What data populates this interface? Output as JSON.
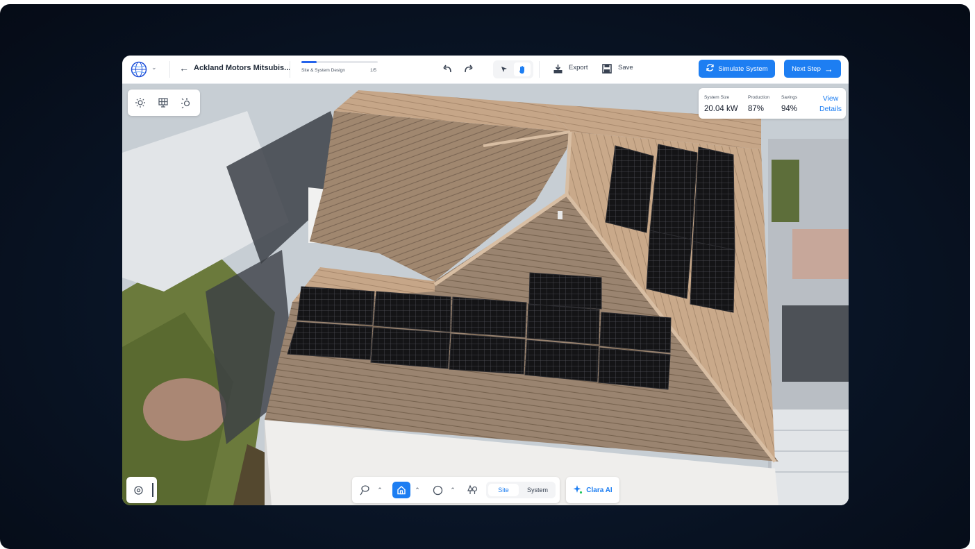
{
  "project": {
    "title": "Ackland Motors Mitsubis...",
    "step_label": "Site & System Design",
    "step_count": "1/5",
    "progress": 0.2
  },
  "toolbar": {
    "export_label": "Export",
    "save_label": "Save",
    "simulate_label": "Simulate System",
    "next_label": "Next Step"
  },
  "stats": {
    "system_size_label": "System Size",
    "system_size_value": "20.04 kW",
    "production_label": "Production",
    "production_value": "87%",
    "savings_label": "Savings",
    "savings_value": "94%",
    "view_details_label": "View Details"
  },
  "bottom": {
    "site_label": "Site",
    "system_label": "System",
    "active_mode": "Site",
    "clara_label": "Clara AI"
  },
  "icons": {
    "logo": "globe-logo-icon",
    "back": "arrow-left-icon",
    "undo": "undo-icon",
    "redo": "redo-icon",
    "select": "cursor-icon",
    "pan": "hand-icon",
    "export": "download-icon",
    "save": "floppy-icon",
    "simulate": "refresh-icon",
    "next": "arrow-right-icon",
    "sun": "sun-icon",
    "panel": "solar-panel-icon",
    "shade": "shade-icon",
    "settings": "gear-icon",
    "lasso": "lasso-icon",
    "house": "house-icon",
    "circle": "circle-icon",
    "trees": "trees-icon",
    "sparkle": "sparkle-icon"
  },
  "colors": {
    "accent": "#1d7ef2",
    "frame": "#0a1628"
  }
}
